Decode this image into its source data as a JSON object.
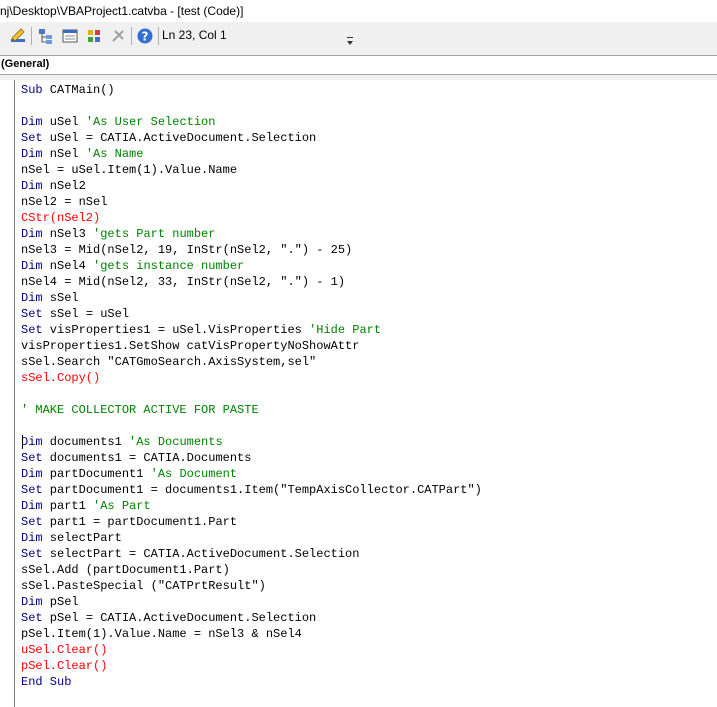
{
  "window": {
    "title": "nj\\Desktop\\VBAProject1.catvba - [test (Code)]"
  },
  "toolbar": {
    "buttons": [
      {
        "name": "design-mode-button",
        "icon": "design-mode-icon"
      },
      {
        "name": "project-explorer-button",
        "icon": "project-explorer-icon"
      },
      {
        "name": "properties-window-button",
        "icon": "properties-icon"
      },
      {
        "name": "object-browser-button",
        "icon": "object-browser-icon"
      },
      {
        "name": "toolbox-button",
        "icon": "toolbox-icon"
      },
      {
        "name": "help-button",
        "icon": "help-icon"
      }
    ],
    "cursor_position": "Ln 23, Col 1"
  },
  "object_combo": {
    "selected": "(General)"
  },
  "colors": {
    "keyword": "#000080",
    "comment": "#008000",
    "error": "#ff0000",
    "text": "#000000"
  },
  "code_lines": [
    [
      [
        "kw",
        "Sub"
      ],
      [
        "tx",
        " CATMain()"
      ]
    ],
    [],
    [
      [
        "kw",
        "Dim"
      ],
      [
        "tx",
        " uSel "
      ],
      [
        "cm",
        "'As User Selection"
      ]
    ],
    [
      [
        "kw",
        "Set"
      ],
      [
        "tx",
        " uSel = CATIA.ActiveDocument.Selection"
      ]
    ],
    [
      [
        "kw",
        "Dim"
      ],
      [
        "tx",
        " nSel "
      ],
      [
        "cm",
        "'As Name"
      ]
    ],
    [
      [
        "tx",
        "nSel = uSel.Item(1).Value.Name"
      ]
    ],
    [
      [
        "kw",
        "Dim"
      ],
      [
        "tx",
        " nSel2"
      ]
    ],
    [
      [
        "tx",
        "nSel2 = nSel"
      ]
    ],
    [
      [
        "er",
        "CStr(nSel2)"
      ]
    ],
    [
      [
        "kw",
        "Dim"
      ],
      [
        "tx",
        " nSel3 "
      ],
      [
        "cm",
        "'gets Part number"
      ]
    ],
    [
      [
        "tx",
        "nSel3 = Mid(nSel2, 19, InStr(nSel2, \".\") - 25)"
      ]
    ],
    [
      [
        "kw",
        "Dim"
      ],
      [
        "tx",
        " nSel4 "
      ],
      [
        "cm",
        "'gets instance number"
      ]
    ],
    [
      [
        "tx",
        "nSel4 = Mid(nSel2, 33, InStr(nSel2, \".\") - 1)"
      ]
    ],
    [
      [
        "kw",
        "Dim"
      ],
      [
        "tx",
        " sSel"
      ]
    ],
    [
      [
        "kw",
        "Set"
      ],
      [
        "tx",
        " sSel = uSel"
      ]
    ],
    [
      [
        "kw",
        "Set"
      ],
      [
        "tx",
        " visProperties1 = uSel.VisProperties "
      ],
      [
        "cm",
        "'Hide Part"
      ]
    ],
    [
      [
        "tx",
        "visProperties1.SetShow catVisPropertyNoShowAttr"
      ]
    ],
    [
      [
        "tx",
        "sSel.Search \"CATGmoSearch.AxisSystem,sel\""
      ]
    ],
    [
      [
        "er",
        "sSel.Copy()"
      ]
    ],
    [],
    [
      [
        "cm",
        "' MAKE COLLECTOR ACTIVE FOR PASTE"
      ]
    ],
    [],
    [
      [
        "kw",
        "Dim"
      ],
      [
        "tx",
        " documents1 "
      ],
      [
        "cm",
        "'As Documents"
      ]
    ],
    [
      [
        "kw",
        "Set"
      ],
      [
        "tx",
        " documents1 = CATIA.Documents"
      ]
    ],
    [
      [
        "kw",
        "Dim"
      ],
      [
        "tx",
        " partDocument1 "
      ],
      [
        "cm",
        "'As Document"
      ]
    ],
    [
      [
        "kw",
        "Set"
      ],
      [
        "tx",
        " partDocument1 = documents1.Item(\"TempAxisCollector.CATPart\")"
      ]
    ],
    [
      [
        "kw",
        "Dim"
      ],
      [
        "tx",
        " part1 "
      ],
      [
        "cm",
        "'As Part"
      ]
    ],
    [
      [
        "kw",
        "Set"
      ],
      [
        "tx",
        " part1 = partDocument1.Part"
      ]
    ],
    [
      [
        "kw",
        "Dim"
      ],
      [
        "tx",
        " selectPart"
      ]
    ],
    [
      [
        "kw",
        "Set"
      ],
      [
        "tx",
        " selectPart = CATIA.ActiveDocument.Selection"
      ]
    ],
    [
      [
        "tx",
        "sSel.Add (partDocument1.Part)"
      ]
    ],
    [
      [
        "tx",
        "sSel.PasteSpecial (\"CATPrtResult\")"
      ]
    ],
    [
      [
        "kw",
        "Dim"
      ],
      [
        "tx",
        " pSel"
      ]
    ],
    [
      [
        "kw",
        "Set"
      ],
      [
        "tx",
        " pSel = CATIA.ActiveDocument.Selection"
      ]
    ],
    [
      [
        "tx",
        "pSel.Item(1).Value.Name = nSel3 & nSel4"
      ]
    ],
    [
      [
        "er",
        "uSel.Clear()"
      ]
    ],
    [
      [
        "er",
        "pSel.Clear()"
      ]
    ],
    [
      [
        "kw",
        "End Sub"
      ]
    ]
  ]
}
